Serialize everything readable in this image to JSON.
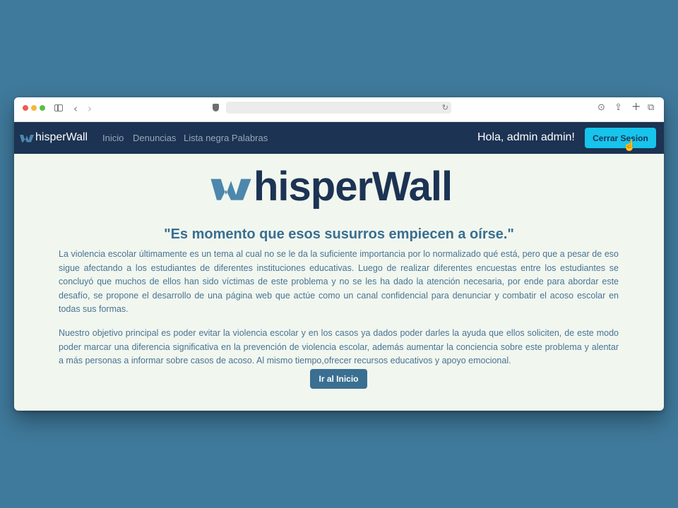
{
  "navbar": {
    "brand": "hisperWall",
    "links": [
      "Inicio",
      "Denuncias",
      "Lista negra Palabras"
    ],
    "greeting": "Hola, admin admin!",
    "logout_label": "Cerrar Sesion"
  },
  "hero": {
    "brand": "hisperWall",
    "slogan": "\"Es momento que esos susurros empiecen a oírse.\"",
    "paragraphs": [
      "La violencia escolar últimamente es un tema al cual no se le da la suficiente importancia por lo normalizado qué está, pero que a pesar de eso sigue afectando a los estudiantes de diferentes instituciones educativas. Luego de realizar diferentes encuestas entre los estudiantes se concluyó que muchos de ellos han sido víctimas de este problema y no se les ha dado la atención necesaria, por ende para abordar este desafío, se propone el desarrollo de una página web que actúe como un canal confidencial para denunciar y combatir el acoso escolar en todas sus formas.",
      "Nuestro objetivo principal es poder evitar la violencia escolar y en los casos ya dados poder darles la ayuda que ellos soliciten, de este modo poder marcar una diferencia significativa en la prevención de violencia escolar, además aumentar la conciencia sobre este problema y alentar a más personas a informar sobre casos de acoso. Al mismo tiempo,ofrecer recursos educativos y apoyo emocional."
    ],
    "cta_label": "Ir al Inicio"
  },
  "icons": {
    "back": "chevron-left-icon",
    "forward": "chevron-right-icon",
    "reload": "reload-icon",
    "download": "download-icon",
    "share": "share-icon",
    "new_tab": "plus-icon",
    "tabs": "tabs-icon"
  },
  "colors": {
    "background": "#3f799b",
    "navbar": "#1c3353",
    "logout_button": "#16c4ec",
    "cta_button": "#3a6f92",
    "page_bg": "#f1f7ef"
  }
}
